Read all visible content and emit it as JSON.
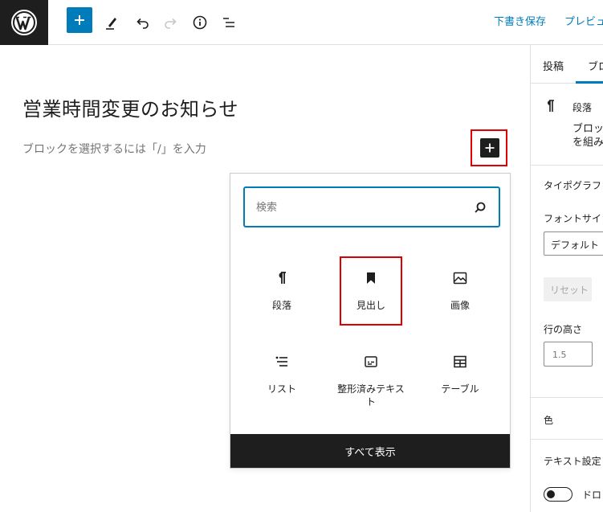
{
  "toolbar": {
    "save_draft": "下書き保存",
    "preview": "プレビュ"
  },
  "editor": {
    "title": "営業時間変更のお知らせ",
    "placeholder": "ブロックを選択するには「/」を入力"
  },
  "inserter": {
    "search_placeholder": "検索",
    "blocks": [
      {
        "label": "段落",
        "icon": "paragraph-icon"
      },
      {
        "label": "見出し",
        "icon": "bookmark-icon"
      },
      {
        "label": "画像",
        "icon": "image-icon"
      },
      {
        "label": "リスト",
        "icon": "list-icon"
      },
      {
        "label": "整形済みテキスト",
        "icon": "preformatted-icon"
      },
      {
        "label": "テーブル",
        "icon": "table-icon"
      }
    ],
    "show_all": "すべて表示"
  },
  "sidebar": {
    "tabs": [
      "投稿",
      "ブロ"
    ],
    "block_name": "段落",
    "block_desc_1": "ブロッ",
    "block_desc_2": "を組み",
    "typography": "タイポグラフ",
    "font_size_label": "フォントサイ",
    "font_size_value": "デフォルト",
    "reset": "リセット",
    "line_height_label": "行の高さ",
    "line_height_placeholder": "1.5",
    "color": "色",
    "text_settings": "テキスト設定",
    "drop_cap": "ドロ"
  },
  "colors": {
    "accent": "#007cba",
    "dark": "#1e1e1e",
    "highlight": "#e00000"
  }
}
